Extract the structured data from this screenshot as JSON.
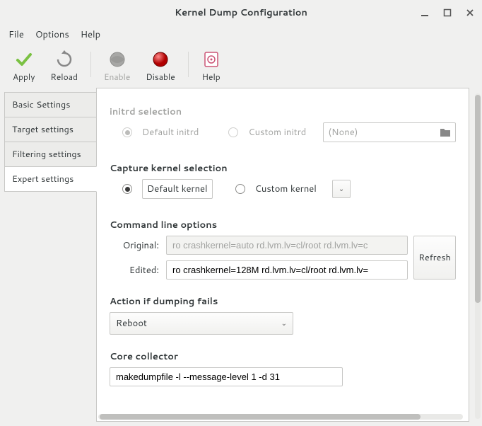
{
  "window": {
    "title": "Kernel Dump Configuration"
  },
  "menubar": {
    "file": "File",
    "options": "Options",
    "help": "Help"
  },
  "toolbar": {
    "apply": "Apply",
    "reload": "Reload",
    "enable": "Enable",
    "disable": "Disable",
    "help": "Help"
  },
  "tabs": {
    "basic": "Basic Settings",
    "target": "Target settings",
    "filtering": "Filtering settings",
    "expert": "Expert settings"
  },
  "initrd": {
    "heading": "initrd selection",
    "default_label": "Default initrd",
    "custom_label": "Custom initrd",
    "file_value": "(None)"
  },
  "capture": {
    "heading": "Capture kernel selection",
    "default_label": "Default kernel",
    "custom_label": "Custom kernel"
  },
  "cmdline": {
    "heading": "Command line options",
    "original_label": "Original:",
    "edited_label": "Edited:",
    "original_value": "ro crashkernel=auto rd.lvm.lv=cl/root rd.lvm.lv=c",
    "edited_value": "ro crashkernel=128M rd.lvm.lv=cl/root rd.lvm.lv=",
    "refresh": "Refresh"
  },
  "action": {
    "heading": "Action if dumping fails",
    "value": "Reboot"
  },
  "collector": {
    "heading": "Core collector",
    "value": "makedumpfile -l --message-level 1 -d 31"
  }
}
